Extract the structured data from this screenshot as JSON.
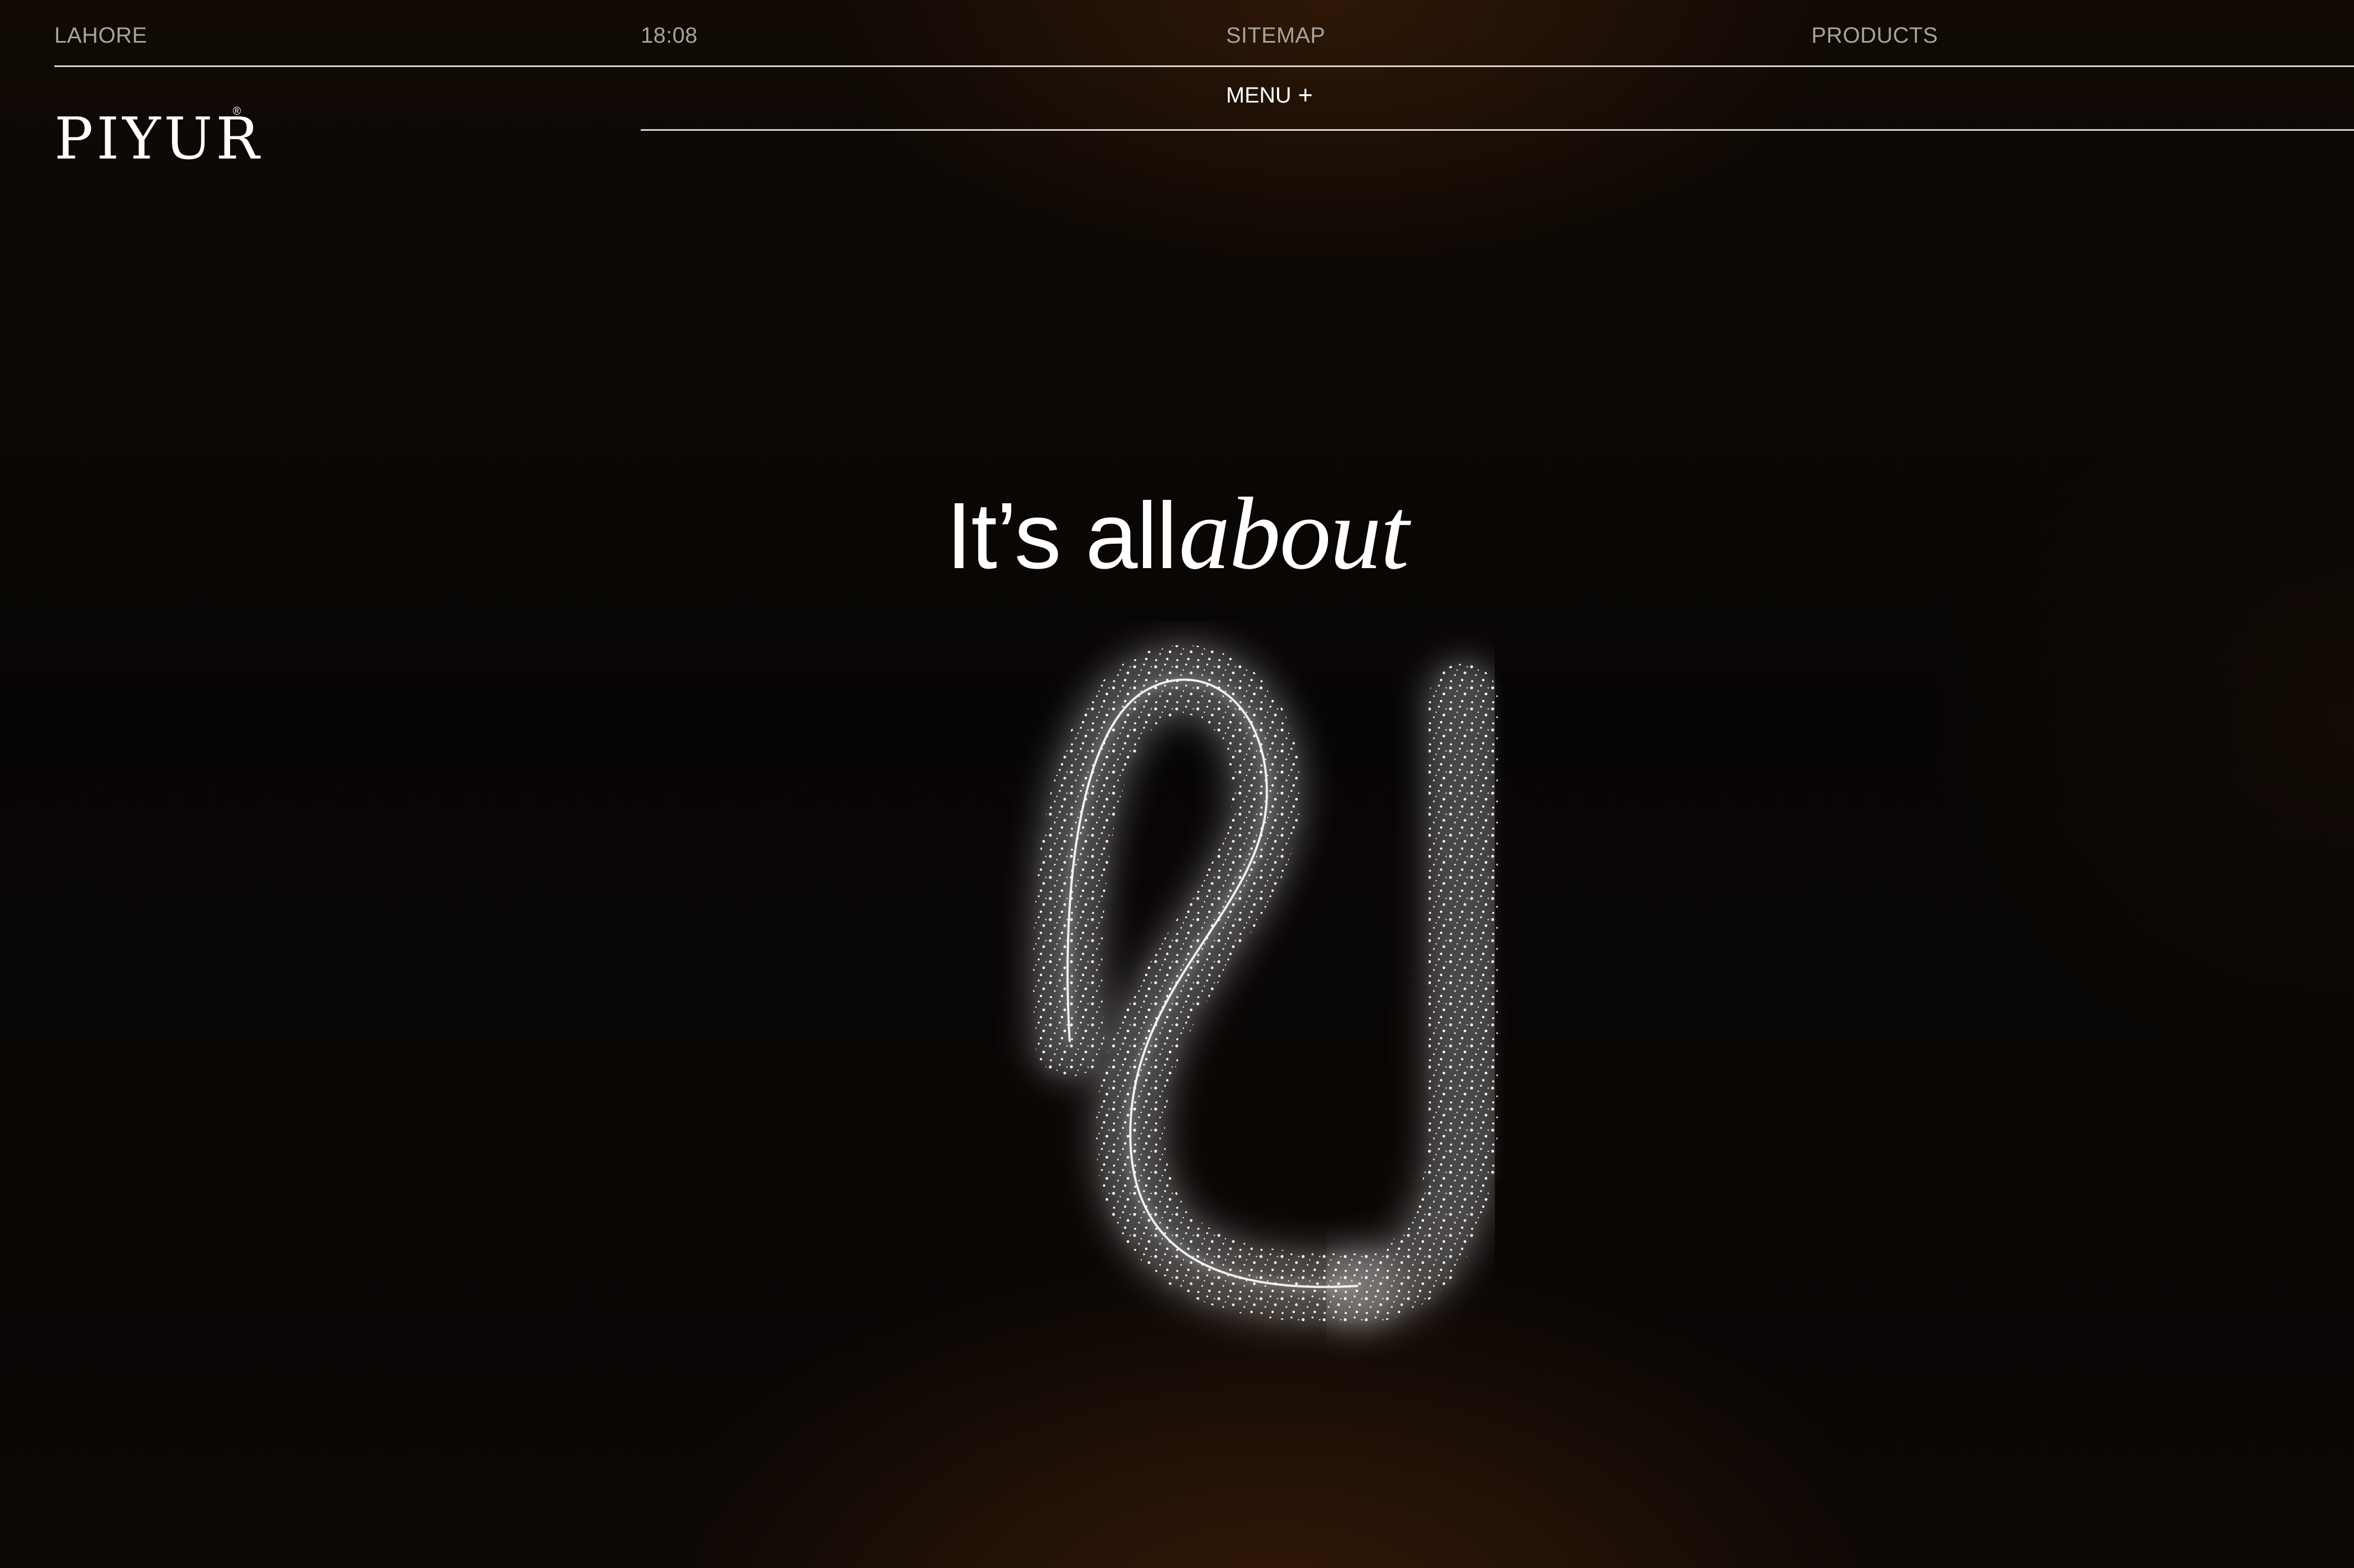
{
  "topbar": {
    "location": "LAHORE",
    "time": "18:08",
    "sitemap_label": "SITEMAP",
    "products_label": "PRODUCTS"
  },
  "menu": {
    "label": "MENU",
    "icon": "plus-icon",
    "plus_glyph": "+"
  },
  "brand": {
    "logo_text": "PIYUR",
    "registered_mark": "®"
  },
  "hero": {
    "heading_regular": "It’s all",
    "heading_italic": "about",
    "symbol": "sparkle-u-logo-mark"
  },
  "colors": {
    "background": "#090604",
    "accent_glow": "#5f2d0a",
    "text": "#ffffff",
    "muted_text": "#a8a29d",
    "rule": "#d8d4d0"
  }
}
